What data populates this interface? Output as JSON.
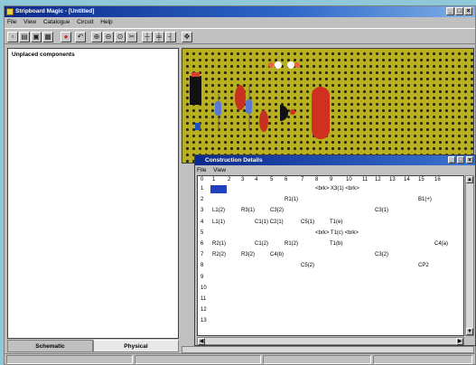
{
  "app": {
    "title": "Stripboard Magic - [Untitled]"
  },
  "menu": [
    "File",
    "View",
    "Catalogue",
    "Circuit",
    "Help"
  ],
  "toolbar_icons": [
    "new-icon",
    "open-icon",
    "save-icon",
    "print-icon",
    "stop-icon",
    "undo-icon",
    "zoom-in-icon",
    "zoom-out-icon",
    "zoom-fit-icon",
    "track-cut-icon",
    "link-icon",
    "component-icon",
    "probe-icon",
    "move-icon"
  ],
  "left_panel": {
    "header": "Unplaced components"
  },
  "tabs": [
    {
      "label": "Schematic"
    },
    {
      "label": "Physical"
    }
  ],
  "construction": {
    "title": "Construction Details",
    "menu": [
      "File",
      "View"
    ],
    "columns": [
      "0",
      "1",
      "2",
      "3",
      "4",
      "5",
      "6",
      "7",
      "8",
      "9",
      "10",
      "11",
      "12",
      "13",
      "14",
      "15",
      "16"
    ],
    "rows": [
      "1",
      "2",
      "3",
      "4",
      "5",
      "6",
      "7",
      "8",
      "9",
      "10",
      "11",
      "12",
      "13"
    ],
    "cells": [
      {
        "row": 0,
        "col": 8,
        "text": "<brk> X3(1) <brk>"
      },
      {
        "row": 1,
        "col": 6,
        "text": "R1(1)"
      },
      {
        "row": 1,
        "col": 15,
        "text": "B1(+)"
      },
      {
        "row": 2,
        "col": 1,
        "text": "L1(2)"
      },
      {
        "row": 2,
        "col": 3,
        "text": "R3(1)"
      },
      {
        "row": 2,
        "col": 5,
        "text": "C3(2)"
      },
      {
        "row": 2,
        "col": 12,
        "text": "C3(1)"
      },
      {
        "row": 3,
        "col": 1,
        "text": "L1(1)"
      },
      {
        "row": 3,
        "col": 4,
        "text": "C1(1) C2(1)"
      },
      {
        "row": 3,
        "col": 7,
        "text": "C5(1)"
      },
      {
        "row": 3,
        "col": 9,
        "text": "T1(e)"
      },
      {
        "row": 4,
        "col": 8,
        "text": "<brk> T1(c) <brk>"
      },
      {
        "row": 5,
        "col": 1,
        "text": "R2(1)"
      },
      {
        "row": 5,
        "col": 4,
        "text": "C1(2)"
      },
      {
        "row": 5,
        "col": 6,
        "text": "R1(2)"
      },
      {
        "row": 5,
        "col": 9,
        "text": "T1(b)"
      },
      {
        "row": 5,
        "col": 16,
        "text": "C4(a)"
      },
      {
        "row": 6,
        "col": 1,
        "text": "R2(2)"
      },
      {
        "row": 6,
        "col": 3,
        "text": "R3(2)"
      },
      {
        "row": 6,
        "col": 5,
        "text": "C4(b)"
      },
      {
        "row": 6,
        "col": 12,
        "text": "C3(2)"
      },
      {
        "row": 7,
        "col": 7,
        "text": "C5(2)"
      },
      {
        "row": 7,
        "col": 15,
        "text": "CP2"
      }
    ]
  },
  "colors": {
    "board": "#b8b020",
    "titlebar": "#0a2a8c",
    "highlight": "#2040c0",
    "component_red": "#d03020"
  }
}
